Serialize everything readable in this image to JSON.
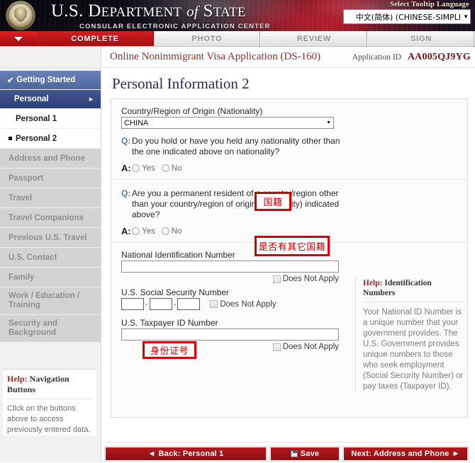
{
  "header": {
    "dept_title_main": "U.S. D",
    "dept_title": "U.S. DEPARTMENT of STATE",
    "dept_subtitle": "CONSULAR ELECTRONIC APPLICATION CENTER",
    "seal_icon": "us-state-department-seal-icon",
    "language_label": "Select Tooltip Language",
    "language_value": "中文(简体) (CHINESE-SIMPLI",
    "language_arrow_icon": "chevron-down-icon"
  },
  "tabs": {
    "arrow_icon": "caret-down-icon",
    "items": [
      {
        "label": "COMPLETE",
        "active": true
      },
      {
        "label": "PHOTO",
        "active": false
      },
      {
        "label": "REVIEW",
        "active": false
      },
      {
        "label": "SIGN",
        "active": false
      }
    ]
  },
  "app_bar": {
    "application_name": "Online Nonimmigrant Visa Application (DS-160)",
    "application_id_label": "Application ID",
    "application_id_value": "AA005QJ9YG"
  },
  "sidebar": {
    "items": [
      {
        "label": "Getting Started",
        "state": "done",
        "check_icon": "check-icon"
      },
      {
        "label": "Personal",
        "state": "current-group",
        "chevron_icon": "chevron-right-icon"
      },
      {
        "label": "Personal 1",
        "state": "sub"
      },
      {
        "label": "Personal 2",
        "state": "sub-active"
      },
      {
        "label": "Address and Phone",
        "state": "disabled"
      },
      {
        "label": "Passport",
        "state": "disabled"
      },
      {
        "label": "Travel",
        "state": "disabled"
      },
      {
        "label": "Travel Companions",
        "state": "disabled"
      },
      {
        "label": "Previous U.S. Travel",
        "state": "disabled"
      },
      {
        "label": "U.S. Contact",
        "state": "disabled"
      },
      {
        "label": "Family",
        "state": "disabled"
      },
      {
        "label": "Work / Education / Training",
        "state": "disabled",
        "line1": "Work / Education /",
        "line2": "Training"
      },
      {
        "label": "Security and Background",
        "state": "disabled",
        "line1": "Security and",
        "line2": "Background"
      }
    ],
    "help": {
      "title_word": "Help:",
      "title_rest": " Navigation Buttons",
      "body": "Click on the buttons above to access previously entered data."
    }
  },
  "main": {
    "page_title": "Personal Information 2",
    "nationality": {
      "label": "Country/Region of Origin (Nationality)",
      "value": "CHINA",
      "arrow_icon": "chevron-down-icon"
    },
    "question1": {
      "q_marker": "Q:",
      "a_marker": "A:",
      "text": "Do you hold or have you held any nationality other than the one indicated above on nationality?",
      "options": [
        "Yes",
        "No"
      ]
    },
    "question2": {
      "q_marker": "Q:",
      "a_marker": "A:",
      "text": "Are you a permanent resident of a country/region other than your country/region of origin (nationality) indicated above?",
      "options": [
        "Yes",
        "No"
      ]
    },
    "national_id": {
      "label": "National Identification Number",
      "value": "",
      "does_not_apply": "Does Not Apply"
    },
    "ssn": {
      "label": "U.S. Social Security Number",
      "part1": "",
      "part2": "",
      "part3": "",
      "separator": "-",
      "does_not_apply": "Does Not Apply"
    },
    "taxpayer_id": {
      "label": "U.S. Taxpayer ID Number",
      "value": "",
      "does_not_apply": "Does Not Apply"
    },
    "help_panel": {
      "title_word": "Help:",
      "title_rest": " Identification Numbers",
      "body": "Your National ID Number is a unique number that your government provides. The U.S. Government provides unique numbers to those who seek employment (Social Security Number) or pay taxes (Taxpayer ID)."
    }
  },
  "annotations": [
    {
      "id": "annot-nationality",
      "text": "国籍"
    },
    {
      "id": "annot-other-nat",
      "text": "是否有其它国籍"
    },
    {
      "id": "annot-nat-id",
      "text": "身份证号"
    }
  ],
  "footer": {
    "back_label": "Back: Personal 1",
    "back_icon": "caret-left-icon",
    "save_label": "Save",
    "save_icon": "floppy-disk-icon",
    "next_label": "Next: Address and Phone",
    "next_icon": "caret-right-icon"
  },
  "colors": {
    "brand_red": "#a20f13",
    "accent_red": "#d40000",
    "nav_blue": "#2f4179",
    "title_navy": "#2b2b52",
    "help_red": "#9c2a2a"
  }
}
